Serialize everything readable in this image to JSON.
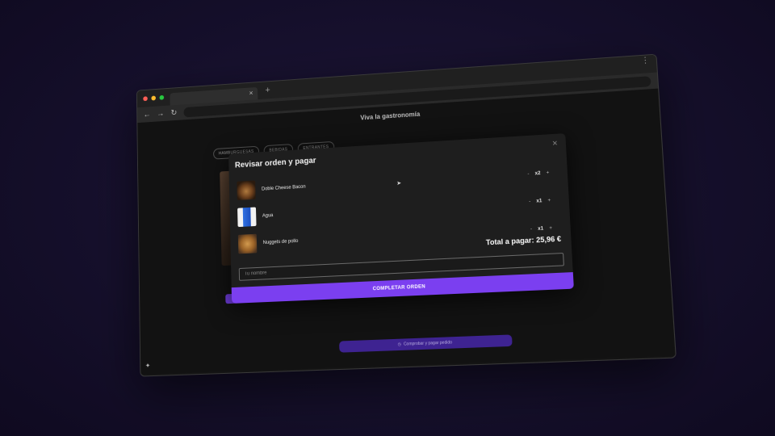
{
  "browser": {
    "tab_close": "×",
    "new_tab": "+",
    "menu": "⋮",
    "nav": {
      "back": "←",
      "forward": "→",
      "reload": "↻"
    },
    "traffic": {
      "red": "#ff5f57",
      "yellow": "#febc2e",
      "green": "#28c840"
    }
  },
  "site": {
    "title": "Viva la gastronomía",
    "categories": [
      "HAMBURGUESAS",
      "BEBIDAS",
      "ENTRANTES"
    ],
    "bottom_button": "Comprobar y pagar pedido",
    "bottom_icon": "◷",
    "corner_icon": "✦"
  },
  "modal": {
    "title": "Revisar orden y pagar",
    "close": "×",
    "items": [
      {
        "name": "Doble Cheese Bacon",
        "qty": "x2",
        "minus": "-",
        "plus": "+"
      },
      {
        "name": "Agua",
        "qty": "x1",
        "minus": "-",
        "plus": "+"
      },
      {
        "name": "Nuggets de pollo",
        "qty": "x1",
        "minus": "-",
        "plus": "+"
      }
    ],
    "total": "Total a pagar: 25,96 €",
    "name_placeholder": "Tu nombre",
    "complete_button": "COMPLETAR ORDEN"
  },
  "colors": {
    "accent": "#7b3ff0",
    "accent_dark": "#3e2391"
  }
}
